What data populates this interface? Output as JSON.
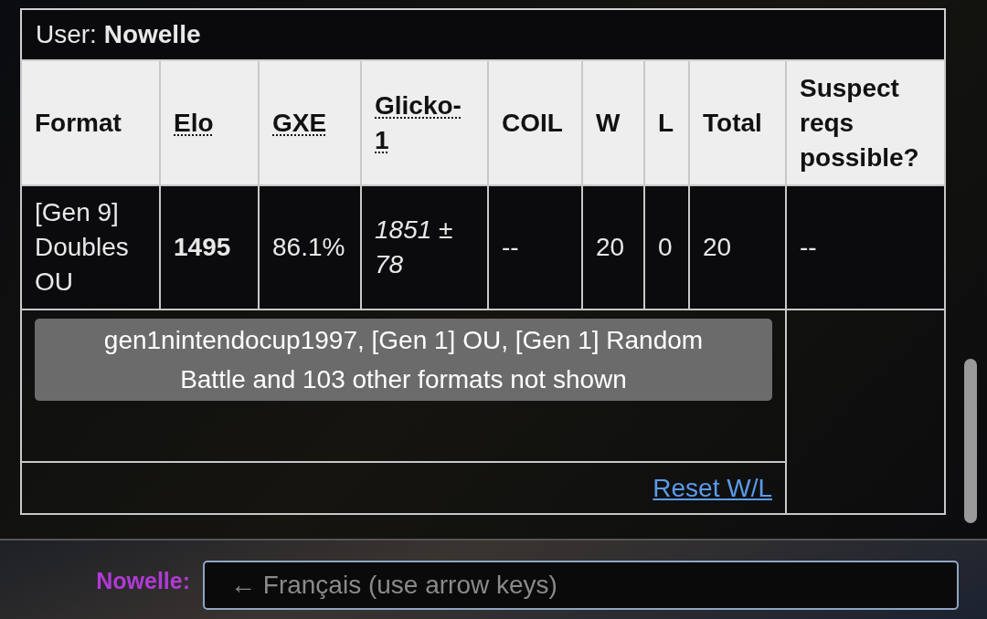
{
  "title": "User: **Nowelle**",
  "columns": [
    {
      "label": "Format",
      "has_tooltip": false
    },
    {
      "label": "Elo",
      "has_tooltip": true
    },
    {
      "label": "GXE",
      "has_tooltip": true
    },
    {
      "label": "Glicko-1",
      "has_tooltip": true
    },
    {
      "label": "COIL",
      "has_tooltip": false
    },
    {
      "label": "W",
      "has_tooltip": false
    },
    {
      "label": "L",
      "has_tooltip": false
    },
    {
      "label": "Total",
      "has_tooltip": false
    },
    {
      "label": "Suspect reqs possible?",
      "has_tooltip": false
    }
  ],
  "rows": [
    [
      {
        "text": "[Gen 9] Doubles OU",
        "kind": "plain"
      },
      {
        "text": "1495",
        "kind": "bold"
      },
      {
        "text": "86.1%",
        "kind": "plain"
      },
      {
        "text": "1851 ± 78",
        "kind": "italic"
      },
      {
        "text": "--",
        "kind": "plain"
      },
      {
        "text": "20",
        "kind": "plain"
      },
      {
        "text": "0",
        "kind": "plain"
      },
      {
        "text": "20",
        "kind": "plain"
      },
      {
        "text": "--",
        "kind": "plain"
      }
    ]
  ],
  "hidden_formats_button": "gen1nintendocup1997, [Gen 1] OU, [Gen 1] Random Battle and 103 other formats not shown",
  "reset_link": "Reset W/L",
  "chat": {
    "user": "Nowelle:",
    "placeholder": "← Français (use arrow keys)"
  }
}
